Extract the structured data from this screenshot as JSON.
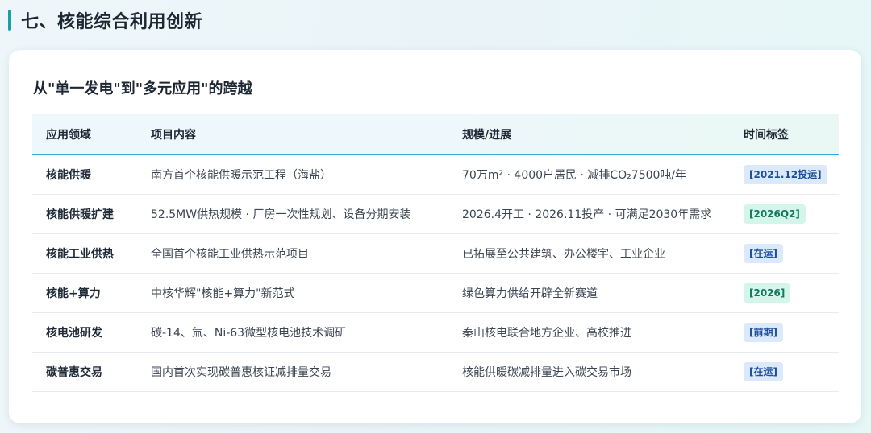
{
  "page": {
    "title": "七、核能综合利用创新"
  },
  "card": {
    "heading": "从\"单一发电\"到\"多元应用\"的跨越"
  },
  "table": {
    "headers": [
      "应用领域",
      "项目内容",
      "规模/进展",
      "时间标签"
    ],
    "rows": [
      {
        "domain": "核能供暖",
        "content": "南方首个核能供暖示范工程（海盐）",
        "progress": "70万m² · 4000户居民 · 减排CO₂7500吨/年",
        "tag": "[2021.12投运]",
        "tag_color": "blue"
      },
      {
        "domain": "核能供暖扩建",
        "content": "52.5MW供热规模 · 厂房一次性规划、设备分期安装",
        "progress": "2026.4开工 · 2026.11投产 · 可满足2030年需求",
        "tag": "[2026Q2]",
        "tag_color": "green"
      },
      {
        "domain": "核能工业供热",
        "content": "全国首个核能工业供热示范项目",
        "progress": "已拓展至公共建筑、办公楼宇、工业企业",
        "tag": "[在运]",
        "tag_color": "blue"
      },
      {
        "domain": "核能+算力",
        "content": "中核华辉\"核能+算力\"新范式",
        "progress": "绿色算力供给开辟全新赛道",
        "tag": "[2026]",
        "tag_color": "green"
      },
      {
        "domain": "核电池研发",
        "content": "碳-14、氚、Ni-63微型核电池技术调研",
        "progress": "秦山核电联合地方企业、高校推进",
        "tag": "[前期]",
        "tag_color": "blue"
      },
      {
        "domain": "碳普惠交易",
        "content": "国内首次实现碳普惠核证减排量交易",
        "progress": "核能供暖碳减排量进入碳交易市场",
        "tag": "[在运]",
        "tag_color": "blue"
      }
    ]
  },
  "colors": {
    "accent": "#17a2a2",
    "header_rule": "#3aa7df",
    "tag_blue_bg": "#dbe9fb",
    "tag_blue_text": "#1d4f9a",
    "tag_green_bg": "#d4f5ea",
    "tag_green_text": "#127a5e"
  }
}
